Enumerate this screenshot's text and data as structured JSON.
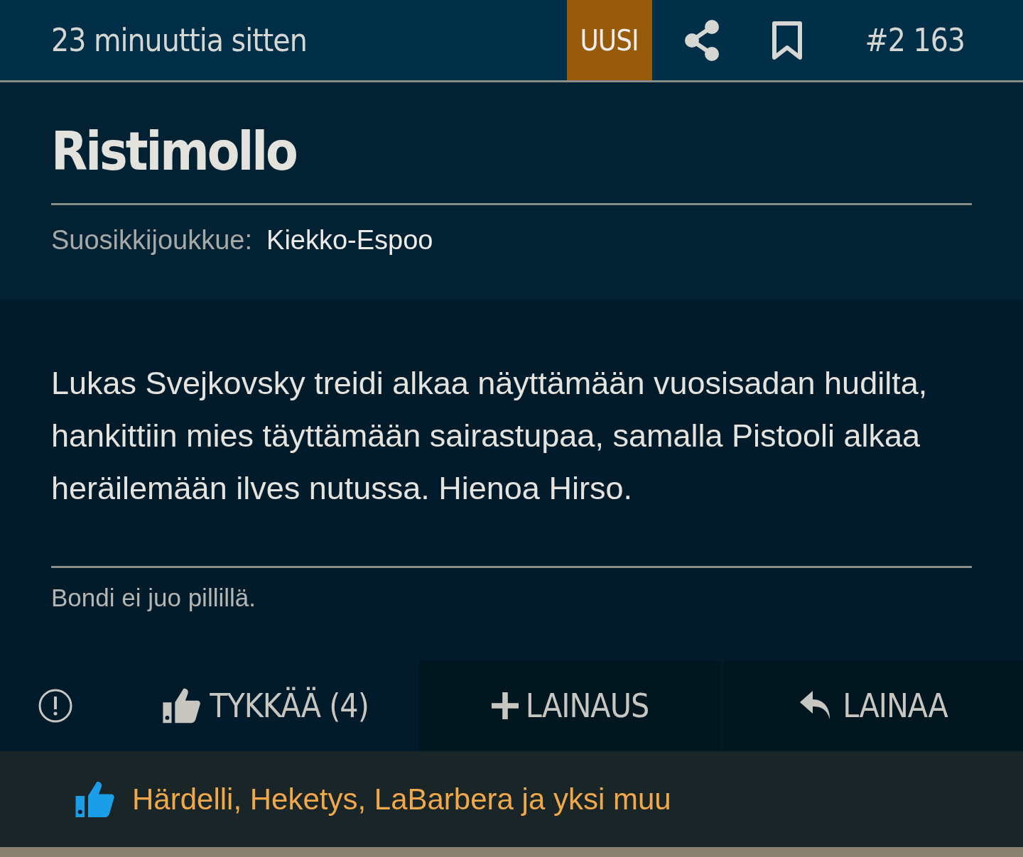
{
  "header": {
    "time": "23 minuuttia sitten",
    "badge": "UUSI",
    "post_number": "#2 163"
  },
  "author": {
    "name": "Ristimollo",
    "team_label": "Suosikkijoukkue:",
    "team": "Kiekko-Espoo"
  },
  "message": "Lukas Svejkovsky treidi alkaa näyttämään vuosisadan hudilta, hankittiin mies täyttämään sairastupaa, samalla Pistooli alkaa heräilemään ilves nutussa. Hienoa Hirso.",
  "signature": "Bondi ei juo pillillä.",
  "actions": [
    {
      "kind": "like",
      "label": "TYKKÄÄ (4)"
    },
    {
      "kind": "add-quote",
      "label": "LAINAUS"
    },
    {
      "kind": "reply",
      "label": "LAINAA"
    }
  ],
  "likers": "Härdelli, Heketys, LaBarbera ja yksi muu"
}
